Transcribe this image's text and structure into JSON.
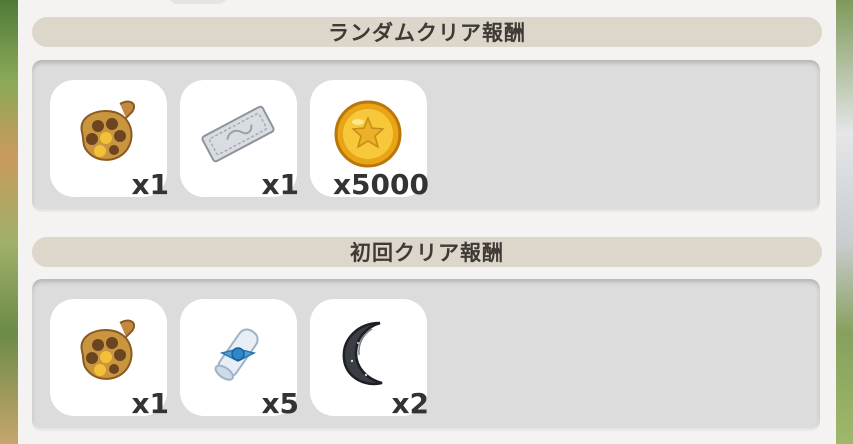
{
  "sections": [
    {
      "title": "ランダムクリア報酬",
      "items": [
        {
          "icon": "honeycomb-icon",
          "quantity": "x1"
        },
        {
          "icon": "silver-ticket-icon",
          "quantity": "x1"
        },
        {
          "icon": "gold-coin-icon",
          "quantity": "x5000"
        }
      ]
    },
    {
      "title": "初回クリア報酬",
      "items": [
        {
          "icon": "honeycomb-icon",
          "quantity": "x1"
        },
        {
          "icon": "scroll-icon",
          "quantity": "x5"
        },
        {
          "icon": "crescent-moon-icon",
          "quantity": "x2"
        }
      ]
    }
  ]
}
